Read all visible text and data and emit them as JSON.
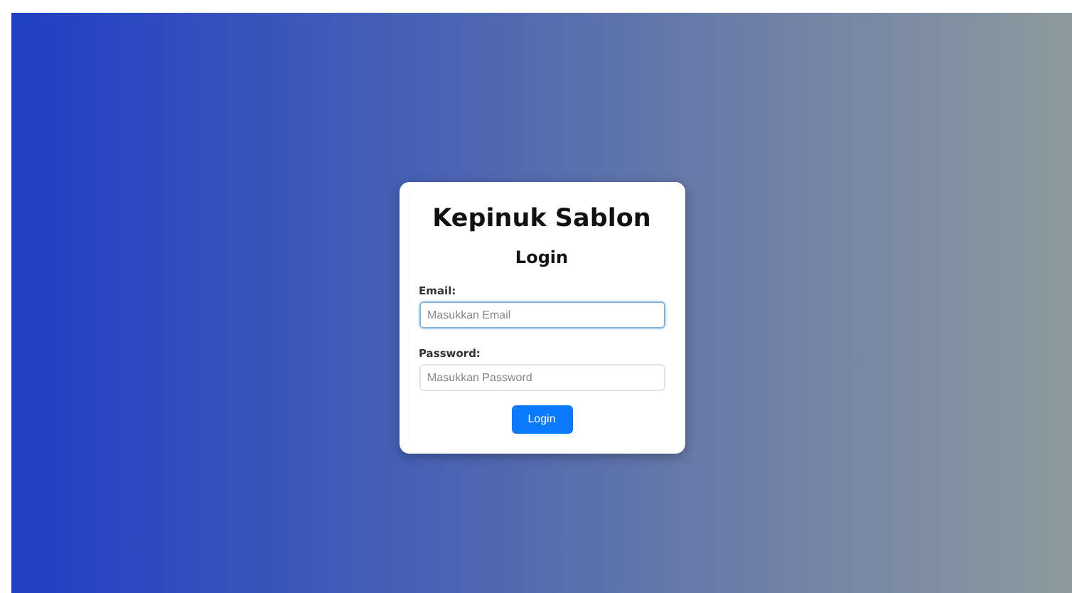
{
  "card": {
    "title": "Kepinuk Sablon",
    "heading": "Login"
  },
  "fields": [
    {
      "label": "Email:",
      "placeholder": "Masukkan Email",
      "focused": true
    },
    {
      "label": "Password:",
      "placeholder": "Masukkan Password",
      "focused": false
    }
  ],
  "button": {
    "label": "Login"
  }
}
